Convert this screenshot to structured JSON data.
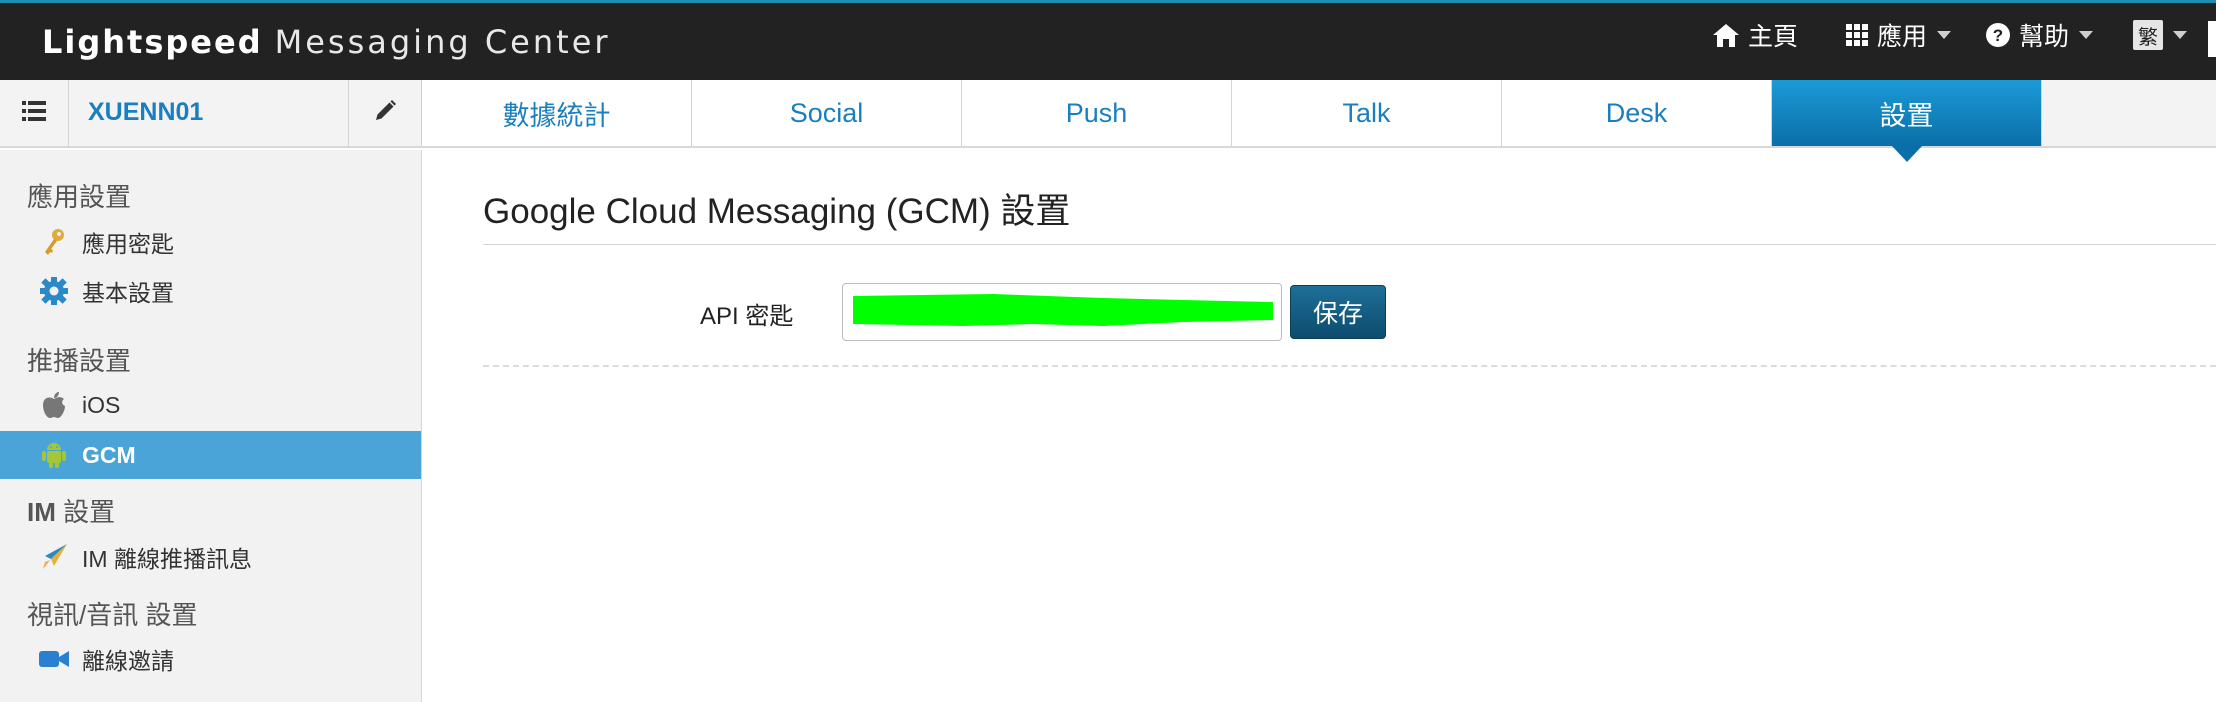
{
  "brand": {
    "bold": "Lightspeed",
    "light": "Messaging Center"
  },
  "topnav": {
    "home": {
      "label": "主頁",
      "icon": "home-icon"
    },
    "apps": {
      "label": "應用",
      "icon": "grid-icon"
    },
    "help": {
      "label": "幫助",
      "icon": "question-circle-icon"
    },
    "lang": {
      "label": "繁"
    }
  },
  "app": {
    "name": "XUENN01"
  },
  "tabs": [
    {
      "label": "數據統計",
      "active": false
    },
    {
      "label": "Social",
      "active": false
    },
    {
      "label": "Push",
      "active": false
    },
    {
      "label": "Talk",
      "active": false
    },
    {
      "label": "Desk",
      "active": false
    },
    {
      "label": "設置",
      "active": true
    }
  ],
  "sidebar": {
    "sections": [
      {
        "heading": "應用設置",
        "items": [
          {
            "label": "應用密匙",
            "icon": "key-icon"
          },
          {
            "label": "基本設置",
            "icon": "gear-icon"
          }
        ]
      },
      {
        "heading": "推播設置",
        "items": [
          {
            "label": "iOS",
            "icon": "apple-icon"
          },
          {
            "label": "GCM",
            "icon": "android-icon",
            "active": true
          }
        ]
      },
      {
        "heading_bold": "IM",
        "heading": " 設置",
        "items": [
          {
            "label": "IM 離線推播訊息",
            "icon": "rocket-icon"
          }
        ]
      },
      {
        "heading": "視訊/音訊 設置",
        "items": [
          {
            "label": "離線邀請",
            "icon": "video-camera-icon"
          }
        ]
      }
    ]
  },
  "main": {
    "title": "Google Cloud Messaging (GCM) 設置",
    "api_key_label": "API 密匙",
    "save_label": "保存"
  },
  "colors": {
    "topbar": "#222222",
    "accent": "#1a7fc0",
    "active_tab": "#0a6fa8",
    "sidebar_active": "#4aa4d8",
    "redaction": "#00ff00"
  }
}
